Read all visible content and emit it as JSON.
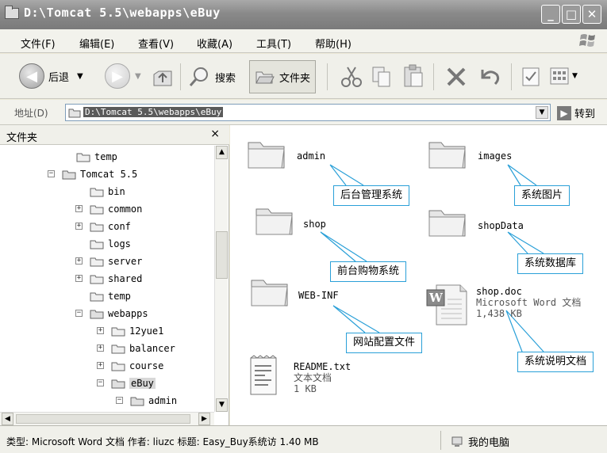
{
  "window": {
    "title": "D:\\Tomcat 5.5\\webapps\\eBuy"
  },
  "menu": [
    "文件(F)",
    "编辑(E)",
    "查看(V)",
    "收藏(A)",
    "工具(T)",
    "帮助(H)"
  ],
  "toolbar": {
    "back_label": "后退",
    "search_label": "搜索",
    "folders_label": "文件夹"
  },
  "address": {
    "label": "地址(D)",
    "value": "D:\\Tomcat 5.5\\webapps\\eBuy",
    "go_label": "转到"
  },
  "folder_pane": {
    "title": "文件夹",
    "close": "×",
    "tree": [
      {
        "label": "temp",
        "expander": ""
      },
      {
        "label": "Tomcat 5.5",
        "expander": "−"
      },
      {
        "label": "bin",
        "expander": ""
      },
      {
        "label": "common",
        "expander": "+"
      },
      {
        "label": "conf",
        "expander": "+"
      },
      {
        "label": "logs",
        "expander": ""
      },
      {
        "label": "server",
        "expander": "+"
      },
      {
        "label": "shared",
        "expander": "+"
      },
      {
        "label": "temp",
        "expander": ""
      },
      {
        "label": "webapps",
        "expander": "−"
      },
      {
        "label": "12yue1",
        "expander": "+"
      },
      {
        "label": "balancer",
        "expander": "+"
      },
      {
        "label": "course",
        "expander": "+"
      },
      {
        "label": "eBuy",
        "expander": "−"
      },
      {
        "label": "admin",
        "expander": "−"
      }
    ]
  },
  "items": {
    "admin": {
      "name": "admin",
      "callout": "后台管理系统"
    },
    "images": {
      "name": "images",
      "callout": "系统图片"
    },
    "shop": {
      "name": "shop",
      "callout": "前台购物系统"
    },
    "shopData": {
      "name": "shopData",
      "callout": "系统数据库"
    },
    "webinf": {
      "name": "WEB-INF",
      "callout": "网站配置文件"
    },
    "shopdoc": {
      "name": "shop.doc",
      "type": "Microsoft Word 文档",
      "size": "1,438 KB",
      "callout": "系统说明文档"
    },
    "readme": {
      "name": "README.txt",
      "type": "文本文档",
      "size": "1 KB"
    }
  },
  "status": {
    "text": "类型: Microsoft Word 文档 作者: liuzc 标题: Easy_Buy系统访 1.40 MB",
    "location": "我的电脑"
  },
  "colors": {
    "callout_border": "#2aa0d8",
    "title_bar": "#8a8a8a"
  }
}
